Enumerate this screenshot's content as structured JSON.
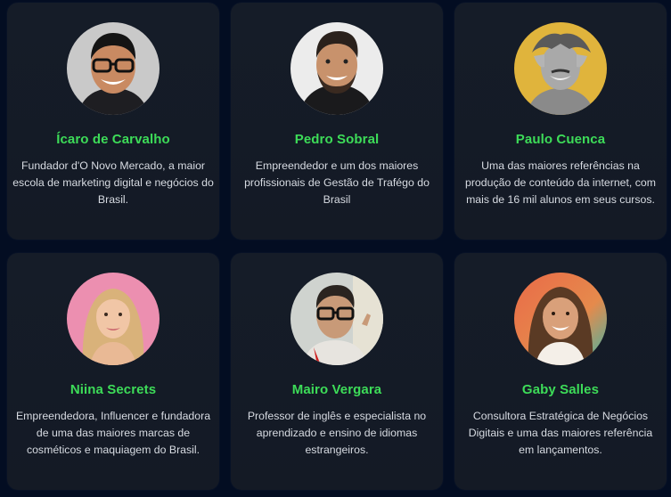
{
  "colors": {
    "background": "#030d22",
    "card": "#151c28",
    "name": "#3ddc58",
    "description": "#d7dbe2"
  },
  "speakers": [
    {
      "name": "Ícaro de Carvalho",
      "description": "Fundador d'O Novo Mercado, a maior escola de marketing digital e negócios do Brasil.",
      "photo_bg": "#c9c9c9"
    },
    {
      "name": "Pedro Sobral",
      "description": "Empreendedor e um dos maiores profissionais de Gestão de Trafégo do Brasil",
      "photo_bg": "#ececec"
    },
    {
      "name": "Paulo Cuenca",
      "description": "Uma das maiores referências na produção de conteúdo da internet, com mais de 16 mil alunos em seus cursos.",
      "photo_bg": "#e0b43c"
    },
    {
      "name": "Niina Secrets",
      "description": "Empreendedora, Influencer e fundadora de uma das maiores marcas de cosméticos e maquiagem do Brasil.",
      "photo_bg": "#ec8fb0"
    },
    {
      "name": "Mairo Vergara",
      "description": "Professor de inglês e especialista no aprendizado e ensino de idiomas estrangeiros.",
      "photo_bg": "#cfd3cf"
    },
    {
      "name": "Gaby Salles",
      "description": "Consultora Estratégica de Negócios Digitais e uma das maiores referência em lançamentos.",
      "photo_bg": "#e57b4c"
    }
  ]
}
